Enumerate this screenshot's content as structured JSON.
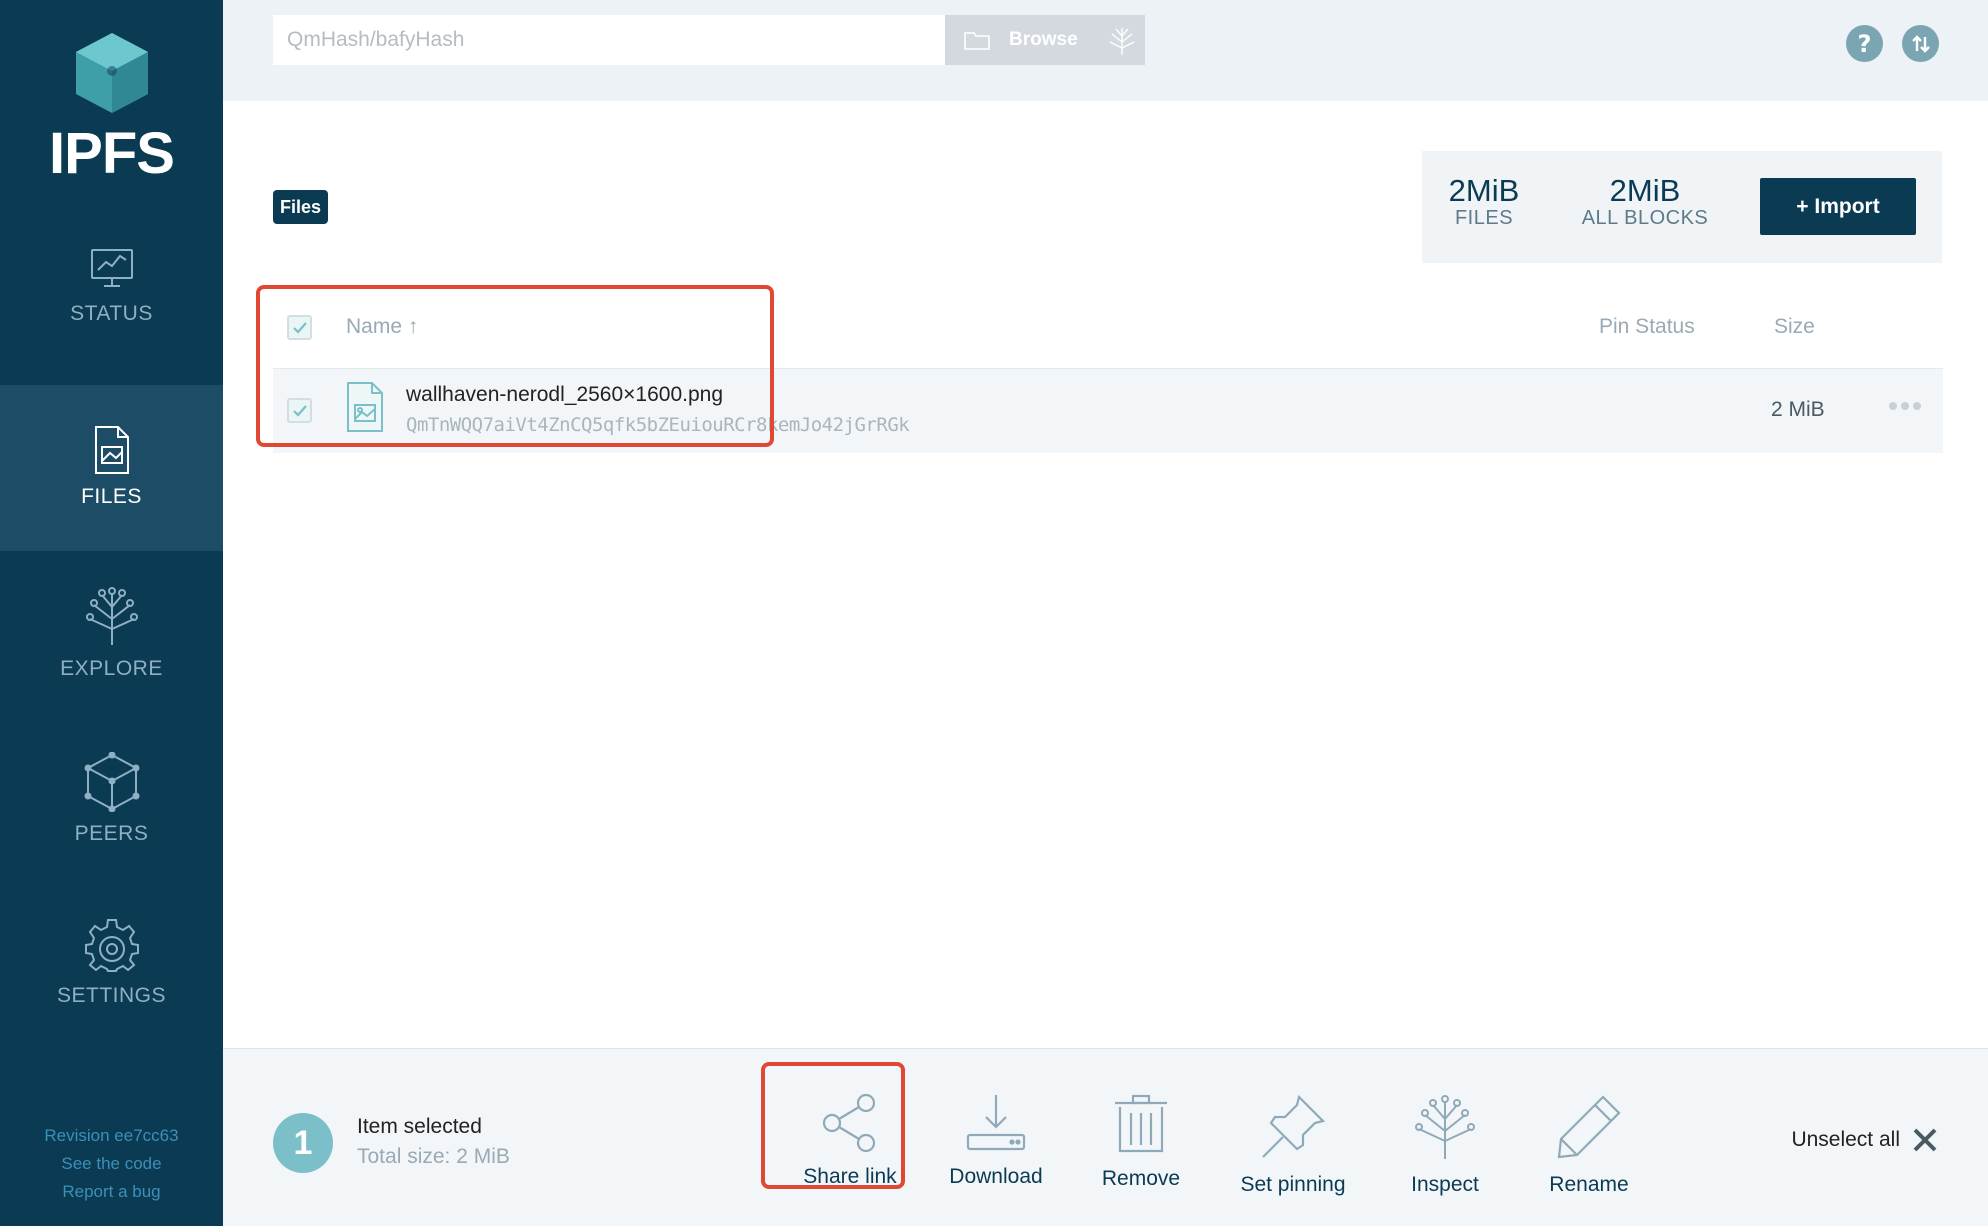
{
  "app": {
    "logo_text": "IPFS"
  },
  "sidebar": {
    "items": [
      {
        "label": "STATUS"
      },
      {
        "label": "FILES"
      },
      {
        "label": "EXPLORE"
      },
      {
        "label": "PEERS"
      },
      {
        "label": "SETTINGS"
      }
    ],
    "active": "FILES",
    "links": {
      "revision": "Revision ee7cc63",
      "code": "See the code",
      "bug": "Report a bug"
    }
  },
  "topbar": {
    "search_placeholder": "QmHash/bafyHash",
    "browse_label": "Browse",
    "help_icon": "help-icon",
    "connection_icon": "connection-icon"
  },
  "files": {
    "breadcrumb": "Files",
    "stats": {
      "files_value": "2MiB",
      "files_label": "FILES",
      "blocks_value": "2MiB",
      "blocks_label": "ALL BLOCKS"
    },
    "import_label": "+ Import",
    "columns": {
      "name": "Name ↑",
      "pin_status": "Pin Status",
      "size": "Size"
    },
    "rows": [
      {
        "name": "wallhaven-nerodl_2560×1600.png",
        "hash": "QmTnWQQ7aiVt4ZnCQ5qfk5bZEuiouRCr8kemJo42jGrRGk",
        "pin_status": "",
        "size": "2 MiB",
        "selected": true
      }
    ]
  },
  "selection": {
    "count": "1",
    "label": "Item selected",
    "total": "Total size: 2 MiB",
    "actions": {
      "share": "Share link",
      "download": "Download",
      "remove": "Remove",
      "pin": "Set pinning",
      "inspect": "Inspect",
      "rename": "Rename"
    },
    "unselect": "Unselect all"
  },
  "colors": {
    "sidebar_bg": "#0b3a53",
    "sidebar_active": "#1d4d66",
    "accent_teal": "#7bbfc9",
    "highlight": "#e04834"
  }
}
